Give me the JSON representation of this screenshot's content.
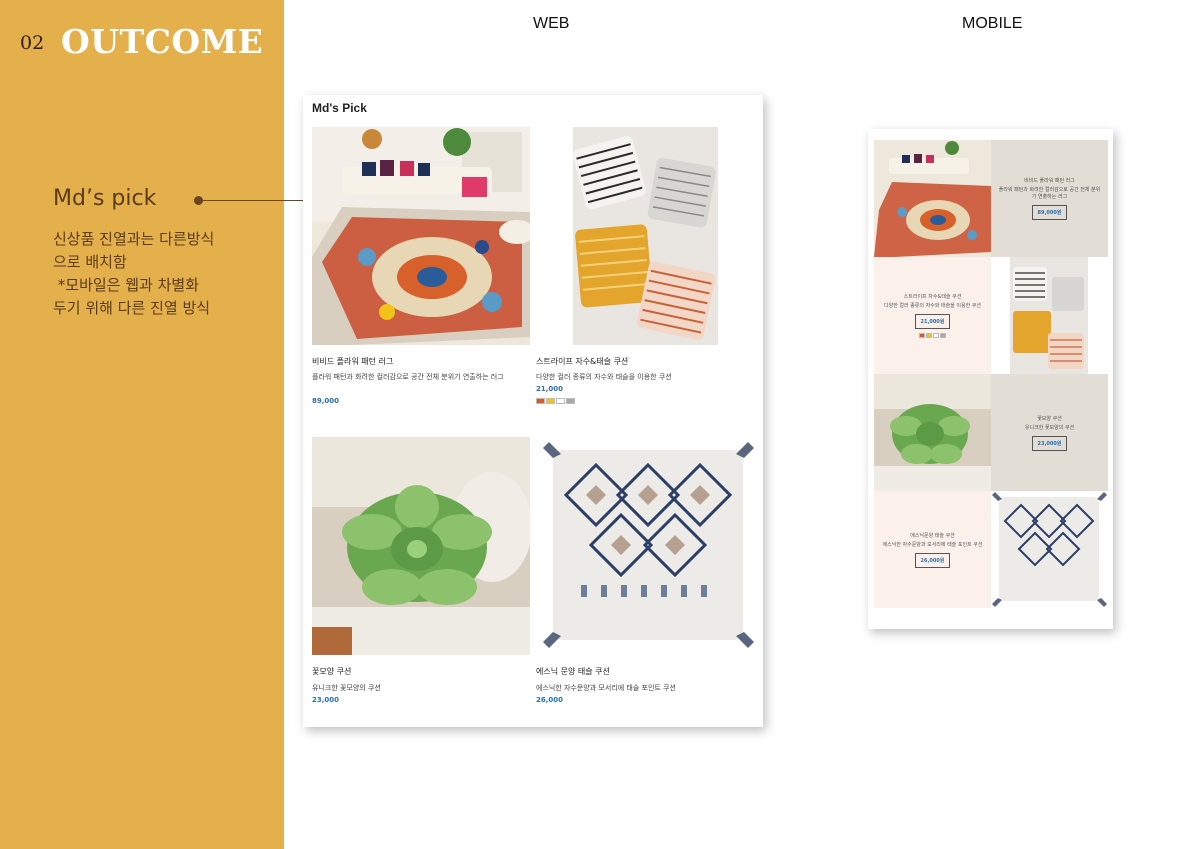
{
  "section": {
    "number": "02",
    "title": "OUTCOME"
  },
  "annotation": {
    "title": "Md’s pick",
    "description": "신상품 진열과는 다른방식\n으로 배치함\n *모바일은 웹과 차별화\n두기 위해 다른 진열 방식"
  },
  "headers": {
    "web": "WEB",
    "mobile": "MOBILE"
  },
  "web": {
    "title": "Md's Pick",
    "products": [
      {
        "name": "비비드 플라워 패턴 러그",
        "desc": "플라워 패턴과 화려한 컬러감으로 공간 전체 분위기 연출하는 러그",
        "price": "89,000"
      },
      {
        "name": "스트라이프 자수&태슬 쿠션",
        "desc": "다양한 컬러 종류의 자수와 태슬을 이용한 쿠션",
        "price": "21,000",
        "swatches": [
          "#e2562a",
          "#f2c418",
          "#ffffff",
          "#a8a8a8"
        ]
      },
      {
        "name": "꽃모양 쿠션",
        "desc": "유니크한 꽃모양의 쿠션",
        "price": "23,000"
      },
      {
        "name": "에스닉 문양 태슬 쿠션",
        "desc": "에스닉한 자수문양과 모서리에 태슬 포인트 쿠션",
        "price": "26,000"
      }
    ]
  },
  "mobile": {
    "items": [
      {
        "name": "비비드 플라워 패턴 러그",
        "desc": "플라워 패턴과 화려한 컬러감으로 공간 전체 분위기 연출하는 러그",
        "price": "89,000원"
      },
      {
        "name": "스트라이프 자수&태슬 쿠션",
        "desc": "다양한 컬러 종류의 자수와 태슬을 이용한 쿠션",
        "price": "21,000원",
        "swatches": [
          "#e2562a",
          "#f2c418",
          "#ffffff",
          "#a8a8a8"
        ]
      },
      {
        "name": "꽃모양 쿠션",
        "desc": "유니크한 꽃모양의 쿠션",
        "price": "23,000원"
      },
      {
        "name": "에스닉문양 태슬 쿠션",
        "desc": "에스닉한 자수문양과 모서리에 태슬 포인트 쿠션",
        "price": "26,000원"
      }
    ]
  },
  "colors": {
    "panel": "#e3b04b",
    "price": "#2a6fb0",
    "mobile_gray": "#e2ddd5",
    "mobile_cream": "#fbf1ea"
  }
}
